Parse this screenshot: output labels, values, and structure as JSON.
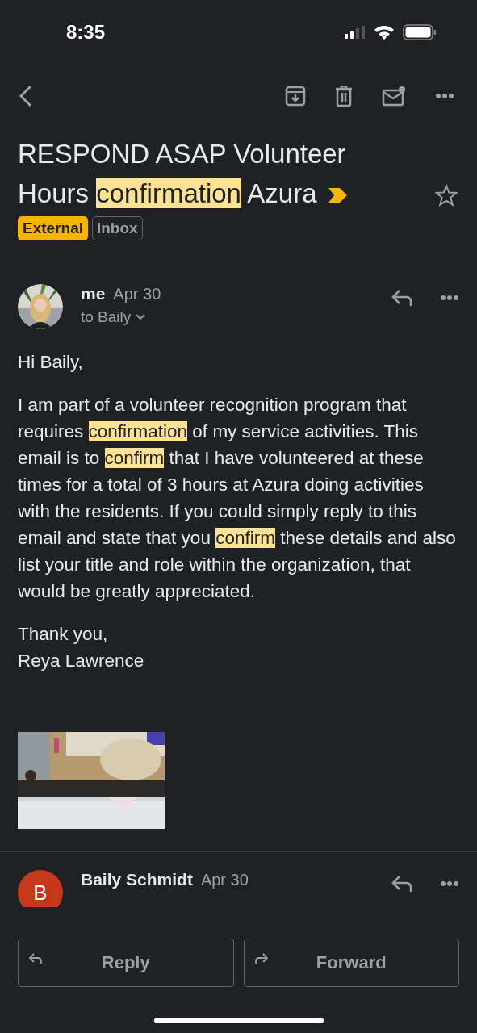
{
  "status_bar": {
    "time": "8:35"
  },
  "subject": [
    {
      "text": "RESPOND ASAP Volunteer Hours ",
      "highlighted": false
    },
    {
      "text": "confirmation",
      "highlighted": true
    },
    {
      "text": " Azura",
      "highlighted": false
    }
  ],
  "important": true,
  "starred": false,
  "labels": [
    {
      "text": "External",
      "kind": "external"
    },
    {
      "text": "Inbox",
      "kind": "inbox"
    }
  ],
  "messages": [
    {
      "sender": "me",
      "date": "Apr 30",
      "recipient": "to Baily",
      "avatar": {
        "kind": "picture"
      },
      "body": [
        [
          {
            "text": "Hi Baily,",
            "highlighted": false
          }
        ],
        [
          {
            "text": "I am part of a volunteer recognition program that requires ",
            "highlighted": false
          },
          {
            "text": "confirmation",
            "highlighted": true
          },
          {
            "text": " of my service activities. This email is to ",
            "highlighted": false
          },
          {
            "text": "confirm",
            "highlighted": true
          },
          {
            "text": " that I have volunteered at these times for a total of 3 hours at Azura doing activities with the residents. If you could simply reply to this email and state that you ",
            "highlighted": false
          },
          {
            "text": "confirm",
            "highlighted": true
          },
          {
            "text": " these details and also list your title and role within the organization, that would be greatly appreciated.",
            "highlighted": false
          }
        ],
        [
          {
            "text": "Thank you,\nReya Lawrence",
            "highlighted": false
          }
        ]
      ],
      "attachment": {
        "kind": "picture"
      }
    },
    {
      "sender": "Baily Schmidt",
      "date": "Apr 30",
      "avatar": {
        "kind": "letter",
        "letter": "B",
        "color": "#c5391a"
      }
    }
  ],
  "actions": [
    {
      "label": "Reply",
      "kind": "reply"
    },
    {
      "label": "Forward",
      "kind": "forward"
    }
  ]
}
